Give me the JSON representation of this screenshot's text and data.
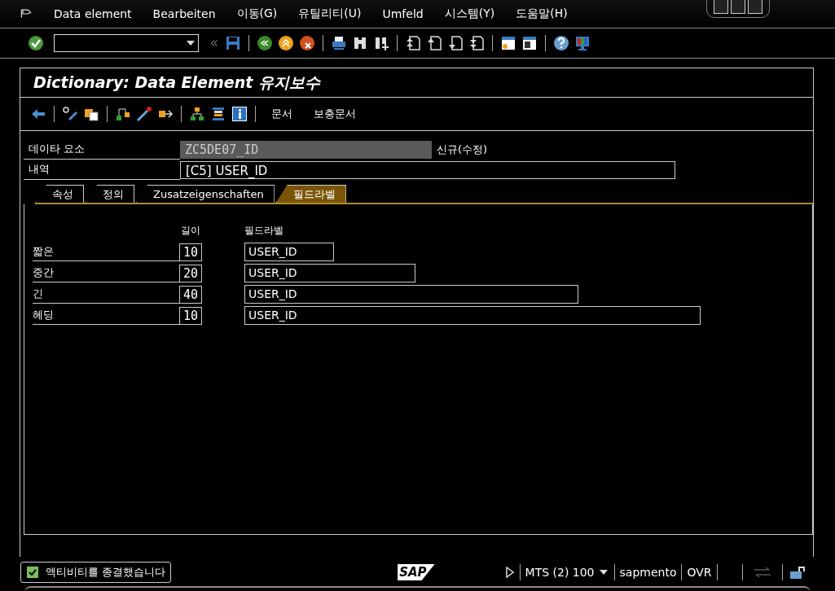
{
  "menu_bar": {
    "items": [
      "Data element",
      "Bearbeiten",
      "이동(G)",
      "유틸리티(U)",
      "Umfeld",
      "시스템(Y)",
      "도움말(H)"
    ]
  },
  "title": "Dictionary: Data Element 유지보수",
  "app_toolbar": {
    "text_buttons": [
      "문서",
      "보충문서"
    ]
  },
  "header_fields": [
    {
      "label": "데이타 요소",
      "value": "ZC5DE07_ID",
      "disabled": true,
      "note": "신규(수정)"
    },
    {
      "label": "내역",
      "value": "[C5] USER_ID",
      "disabled": false
    }
  ],
  "tabs": [
    {
      "label": "속성",
      "selected": false
    },
    {
      "label": "정의",
      "selected": false
    },
    {
      "label": "Zusatzeigenschaften",
      "selected": false
    },
    {
      "label": "필드라벨",
      "selected": true
    }
  ],
  "field_labels": {
    "columns": [
      "길이",
      "필드라벨"
    ],
    "rows": [
      {
        "name": "짧은",
        "length": "10",
        "label": "USER_ID"
      },
      {
        "name": "중간",
        "length": "20",
        "label": "USER_ID"
      },
      {
        "name": "긴",
        "length": "40",
        "label": "USER_ID"
      },
      {
        "name": "헤딩",
        "length": "10",
        "label": "USER_ID"
      }
    ]
  },
  "status_bar": {
    "message": "액티비티를 종결했습니다",
    "logo": "SAP",
    "system": "MTS (2) 100",
    "user": "sapmento",
    "mode": "OVR"
  }
}
